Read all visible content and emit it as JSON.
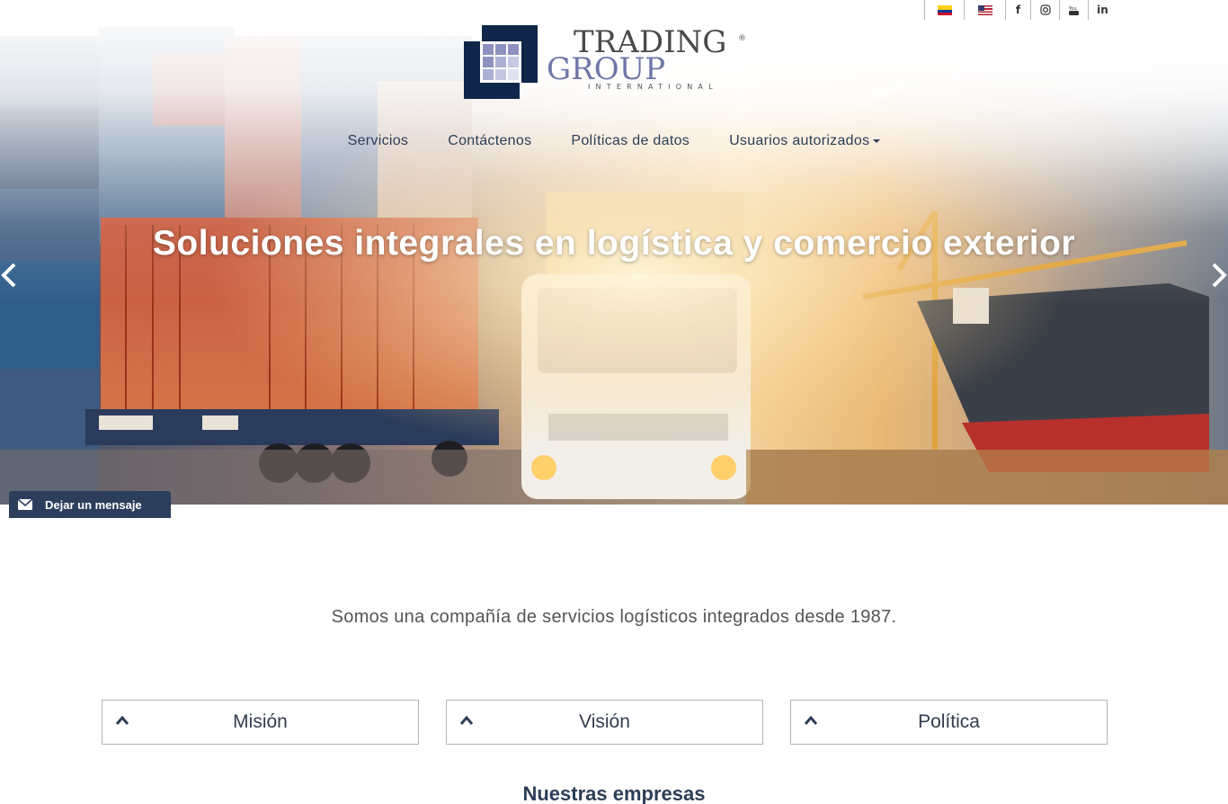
{
  "topbar": {
    "languages": [
      {
        "name": "flag-colombia",
        "label": "Español"
      },
      {
        "name": "flag-usa",
        "label": "English"
      }
    ],
    "social": [
      {
        "icon": "facebook-icon",
        "glyph": "f"
      },
      {
        "icon": "instagram-icon",
        "glyph": "◎"
      },
      {
        "icon": "youtube-icon",
        "glyph": "▶"
      },
      {
        "icon": "linkedin-icon",
        "glyph": "in"
      }
    ]
  },
  "logo": {
    "line1": "TRADING",
    "line2": "GROUP",
    "line3": "INTERNATIONAL",
    "reg": "®",
    "colors": {
      "navy": "#10264a",
      "lavender": "#6f76a8"
    }
  },
  "nav": {
    "items": [
      {
        "label": "Servicios"
      },
      {
        "label": "Contáctenos"
      },
      {
        "label": "Políticas de datos"
      },
      {
        "label": "Usuarios autorizados",
        "dropdown": true
      }
    ]
  },
  "hero": {
    "title": "Soluciones integrales en logística y comercio exterior",
    "prev_icon": "chevron-left-icon",
    "next_icon": "chevron-right-icon"
  },
  "message_tab": {
    "label": "Dejar un mensaje",
    "icon": "envelope-icon",
    "color": "#2c3e5c"
  },
  "main": {
    "tagline": "Somos una compañía de servicios logísticos integrados desde 1987.",
    "cards": [
      {
        "label": "Misión"
      },
      {
        "label": "Visión"
      },
      {
        "label": "Política"
      }
    ],
    "section_title": "Nuestras empresas"
  }
}
